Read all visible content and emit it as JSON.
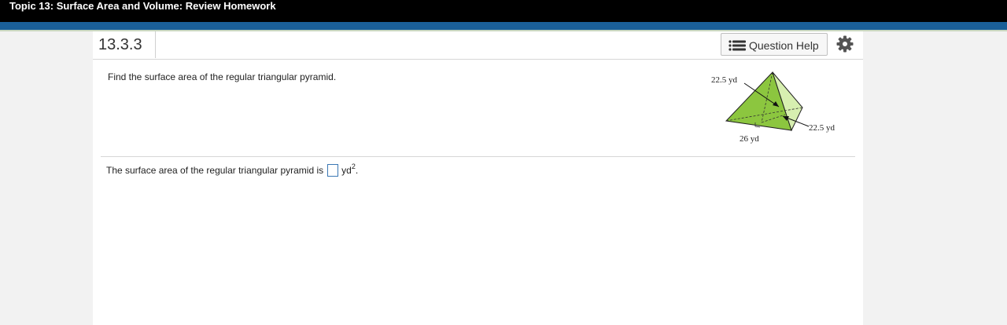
{
  "header": {
    "title": "Topic 13: Surface Area and Volume: Review Homework"
  },
  "question": {
    "number": "13.3.3",
    "help_label": "Question Help",
    "prompt": "Find the surface area of the regular triangular pyramid.",
    "answer_prefix": "The surface area of the regular triangular pyramid is",
    "answer_value": "",
    "answer_unit": "yd",
    "answer_exponent": "2",
    "answer_suffix": "."
  },
  "figure": {
    "label_slant_left": "22.5 yd",
    "label_slant_right": "22.5 yd",
    "label_base": "26 yd",
    "colors": {
      "front_face": "#8cc63f",
      "right_face": "#d7efb0",
      "outline": "#1e1e1e"
    }
  },
  "icons": [
    "list-icon",
    "gear-icon"
  ]
}
